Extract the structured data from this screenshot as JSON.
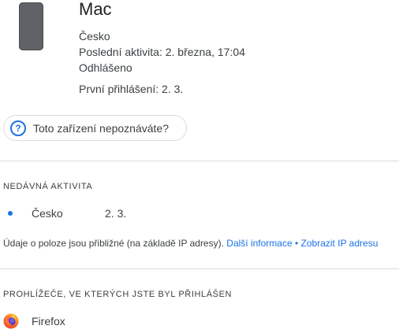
{
  "device": {
    "name": "Mac",
    "country": "Česko",
    "last_activity": "Poslední aktivita: 2. března, 17:04",
    "status": "Odhlášeno",
    "first_login": "První přihlášení: 2. 3."
  },
  "help": {
    "label": "Toto zařízení nepoznáváte?"
  },
  "recent_activity": {
    "heading": "NEDÁVNÁ AKTIVITA",
    "items": [
      {
        "country": "Česko",
        "date": "2. 3."
      }
    ],
    "note": "Údaje o poloze jsou přibližné (na základě IP adresy).",
    "more_info": "Další informace",
    "separator": "•",
    "show_ip": "Zobrazit IP adresu"
  },
  "browsers": {
    "heading": "PROHLÍŽEČE, VE KTERÝCH JSTE BYL PŘIHLÁŠEN",
    "items": [
      {
        "name": "Firefox",
        "icon": "firefox-icon"
      }
    ]
  },
  "colors": {
    "accent": "#1a73e8",
    "divider": "#dadce0",
    "text": "#3c4043"
  }
}
